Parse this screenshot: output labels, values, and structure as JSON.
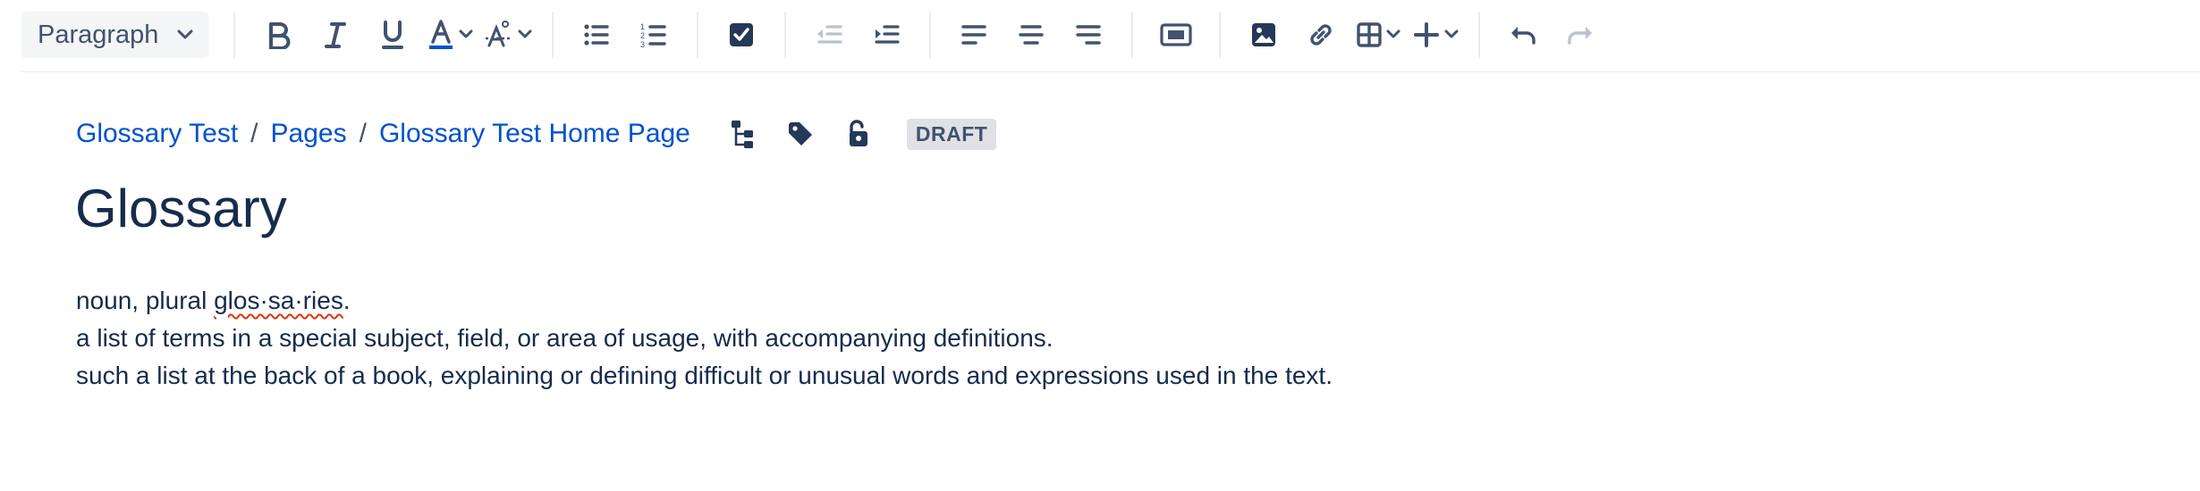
{
  "toolbar": {
    "paragraph_style": "Paragraph",
    "text_color_accent": "#0052cc"
  },
  "breadcrumbs": [
    {
      "label": "Glossary Test"
    },
    {
      "label": "Pages"
    },
    {
      "label": "Glossary Test Home Page"
    }
  ],
  "breadcrumb_separator": "/",
  "page": {
    "status_badge": "DRAFT",
    "title": "Glossary",
    "lines": [
      {
        "before": "noun, plural ",
        "misspelled": "glos·sa·ries",
        "after": "."
      },
      {
        "text": "a list of terms in a special subject, field, or area of usage, with accompanying definitions."
      },
      {
        "text": "such a list at the back of a book, explaining or defining difficult or unusual words and expressions used in the text."
      }
    ]
  },
  "colors": {
    "link": "#0052cc",
    "text": "#172b4d",
    "icon": "#42526e",
    "spellcheck": "#de350b"
  }
}
